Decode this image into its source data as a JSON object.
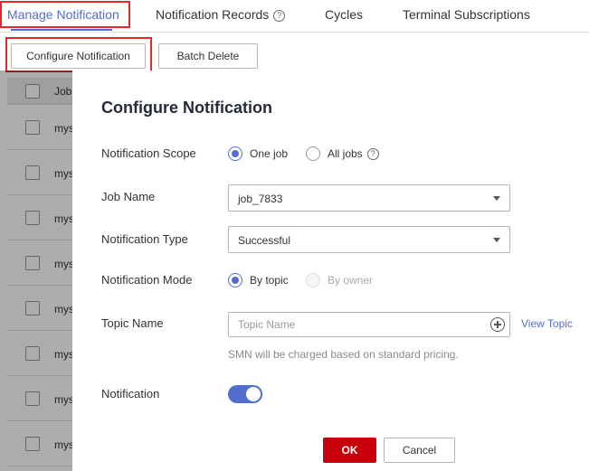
{
  "tabs": [
    {
      "label": "Manage Notification"
    },
    {
      "label": "Notification Records"
    },
    {
      "label": "Cycles"
    },
    {
      "label": "Terminal Subscriptions"
    }
  ],
  "toolbar": {
    "configure_label": "Configure Notification",
    "batch_delete_label": "Batch Delete"
  },
  "table": {
    "header_label": "Job",
    "rows": [
      "mys",
      "mys",
      "mys",
      "mys",
      "mys",
      "mys",
      "mys",
      "mys"
    ]
  },
  "dialog": {
    "title": "Configure Notification",
    "scope": {
      "label": "Notification Scope",
      "option_one": "One job",
      "option_all": "All jobs",
      "selected": "One job"
    },
    "job_name": {
      "label": "Job Name",
      "value": "job_7833"
    },
    "type": {
      "label": "Notification Type",
      "value": "Successful"
    },
    "mode": {
      "label": "Notification Mode",
      "option_topic": "By topic",
      "option_owner": "By owner",
      "selected": "By topic"
    },
    "topic": {
      "label": "Topic Name",
      "placeholder": "Topic Name",
      "value": "",
      "view_link": "View Topic",
      "hint": "SMN will be charged based on standard pricing."
    },
    "notification": {
      "label": "Notification",
      "enabled": true
    },
    "ok_label": "OK",
    "cancel_label": "Cancel"
  },
  "colors": {
    "accent": "#526ecc",
    "primary_button": "#c7000b",
    "highlight_box": "#e12b2b"
  }
}
